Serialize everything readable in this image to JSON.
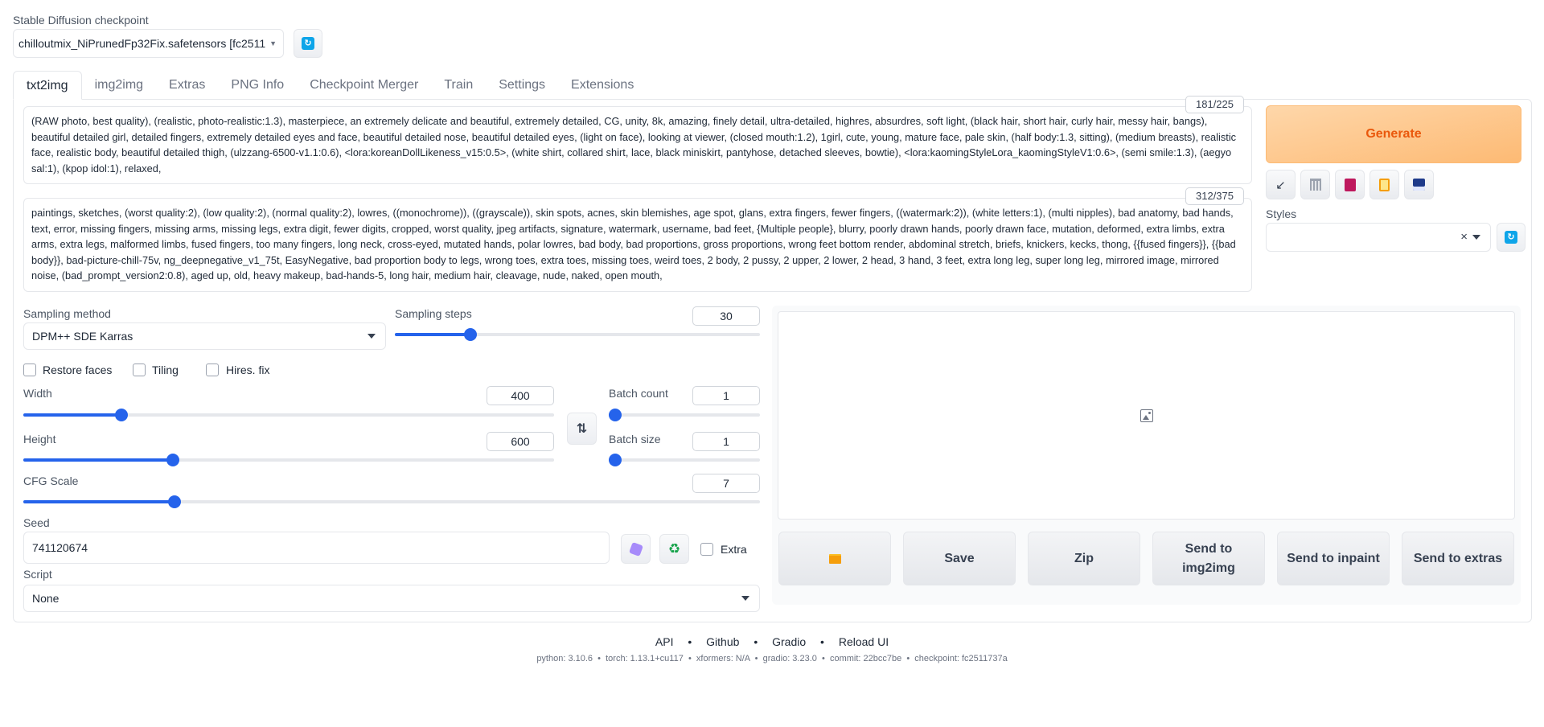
{
  "checkpoint": {
    "label": "Stable Diffusion checkpoint",
    "value": "chilloutmix_NiPrunedFp32Fix.safetensors [fc2511",
    "refresh_icon": "refresh-icon"
  },
  "tabs": [
    {
      "label": "txt2img",
      "active": true
    },
    {
      "label": "img2img"
    },
    {
      "label": "Extras"
    },
    {
      "label": "PNG Info"
    },
    {
      "label": "Checkpoint Merger"
    },
    {
      "label": "Train"
    },
    {
      "label": "Settings"
    },
    {
      "label": "Extensions"
    }
  ],
  "prompt": {
    "counter": "181/225",
    "text": "(RAW photo, best quality), (realistic, photo-realistic:1.3), masterpiece, an extremely delicate and beautiful, extremely detailed, CG, unity, 8k, amazing, finely detail, ultra-detailed, highres, absurdres, soft light, (black hair, short hair, curly hair, messy hair, bangs), beautiful detailed girl, detailed fingers, extremely detailed eyes and face, beautiful detailed nose, beautiful detailed eyes, (light on face), looking at viewer, (closed mouth:1.2), 1girl, cute, young, mature face, pale skin, (half body:1.3, sitting), (medium breasts), realistic face, realistic body, beautiful detailed thigh, (ulzzang-6500-v1.1:0.6), <lora:koreanDollLikeness_v15:0.5>, (white shirt, collared shirt, lace, black miniskirt, pantyhose, detached sleeves, bowtie), <lora:kaomingStyleLora_kaomingStyleV1:0.6>, (semi smile:1.3), (aegyo sal:1), (kpop idol:1), relaxed,"
  },
  "negative_prompt": {
    "counter": "312/375",
    "text": "paintings, sketches, (worst quality:2), (low quality:2), (normal quality:2), lowres, ((monochrome)), ((grayscale)), skin spots, acnes, skin blemishes, age spot, glans, extra fingers, fewer fingers, ((watermark:2)), (white letters:1), (multi nipples), bad anatomy, bad hands, text, error, missing fingers, missing arms, missing legs, extra digit, fewer digits, cropped, worst quality, jpeg artifacts, signature, watermark, username, bad feet, {Multiple people}, blurry, poorly drawn hands, poorly drawn face, mutation, deformed, extra limbs, extra arms, extra legs, malformed limbs, fused fingers, too many fingers, long neck, cross-eyed, mutated hands, polar lowres, bad body, bad proportions, gross proportions, wrong feet bottom render, abdominal stretch, briefs, knickers, kecks, thong, {{fused fingers}}, {{bad body}}, bad-picture-chill-75v, ng_deepnegative_v1_75t, EasyNegative, bad proportion body to legs, wrong toes, extra toes, missing toes, weird toes, 2 body, 2 pussy, 2 upper, 2 lower, 2 head, 3 hand, 3 feet, extra long leg, super long leg, mirrored image, mirrored noise, (bad_prompt_version2:0.8), aged up, old, heavy makeup, bad-hands-5, long hair, medium hair, cleavage, nude, naked, open mouth,"
  },
  "generate": {
    "label": "Generate"
  },
  "tools": [
    {
      "icon": "arrow-icon",
      "glyph": "↙"
    },
    {
      "icon": "trash-icon",
      "glyph": "▐"
    },
    {
      "icon": "style-card-icon",
      "glyph": "■"
    },
    {
      "icon": "clipboard-icon",
      "glyph": "▤"
    },
    {
      "icon": "save-icon",
      "glyph": "▣"
    }
  ],
  "styles": {
    "label": "Styles",
    "value": "",
    "clear": "×"
  },
  "sampling": {
    "method_label": "Sampling method",
    "method_value": "DPM++ SDE Karras",
    "steps_label": "Sampling steps",
    "steps_value": "30",
    "steps_fraction": 0.196
  },
  "checkboxes": {
    "restore_faces": "Restore faces",
    "tiling": "Tiling",
    "hires": "Hires. fix"
  },
  "dims": {
    "width_label": "Width",
    "width_value": "400",
    "width_fraction": 0.177,
    "height_label": "Height",
    "height_value": "600",
    "height_fraction": 0.277,
    "swap_icon": "swap-icon"
  },
  "batch": {
    "count_label": "Batch count",
    "count_value": "1",
    "count_fraction": 0.0,
    "size_label": "Batch size",
    "size_value": "1",
    "size_fraction": 0.0
  },
  "cfg": {
    "label": "CFG Scale",
    "value": "7",
    "fraction": 0.2
  },
  "seed": {
    "label": "Seed",
    "value": "741120674",
    "extra_label": "Extra"
  },
  "script": {
    "label": "Script",
    "value": "None"
  },
  "output": {
    "image_placeholder_icon": "image-icon",
    "buttons": [
      {
        "name": "open-folder-button",
        "label": "",
        "icon": "folder-icon"
      },
      {
        "name": "save-button",
        "label": "Save"
      },
      {
        "name": "zip-button",
        "label": "Zip"
      },
      {
        "name": "send-to-img2img-button",
        "label": "Send to img2img"
      },
      {
        "name": "send-to-inpaint-button",
        "label": "Send to inpaint"
      },
      {
        "name": "send-to-extras-button",
        "label": "Send to extras"
      }
    ]
  },
  "footer": {
    "links": [
      "API",
      "Github",
      "Gradio",
      "Reload UI"
    ],
    "sep": "•",
    "info": "python: 3.10.6  •  torch: 1.13.1+cu117  •  xformers: N/A  •  gradio: 3.23.0  •  commit: 22bcc7be  •  checkpoint: fc2511737a"
  },
  "colors": {
    "accent": "#2563eb",
    "generate_bg": "#fdba74",
    "generate_text": "#ea580c"
  }
}
